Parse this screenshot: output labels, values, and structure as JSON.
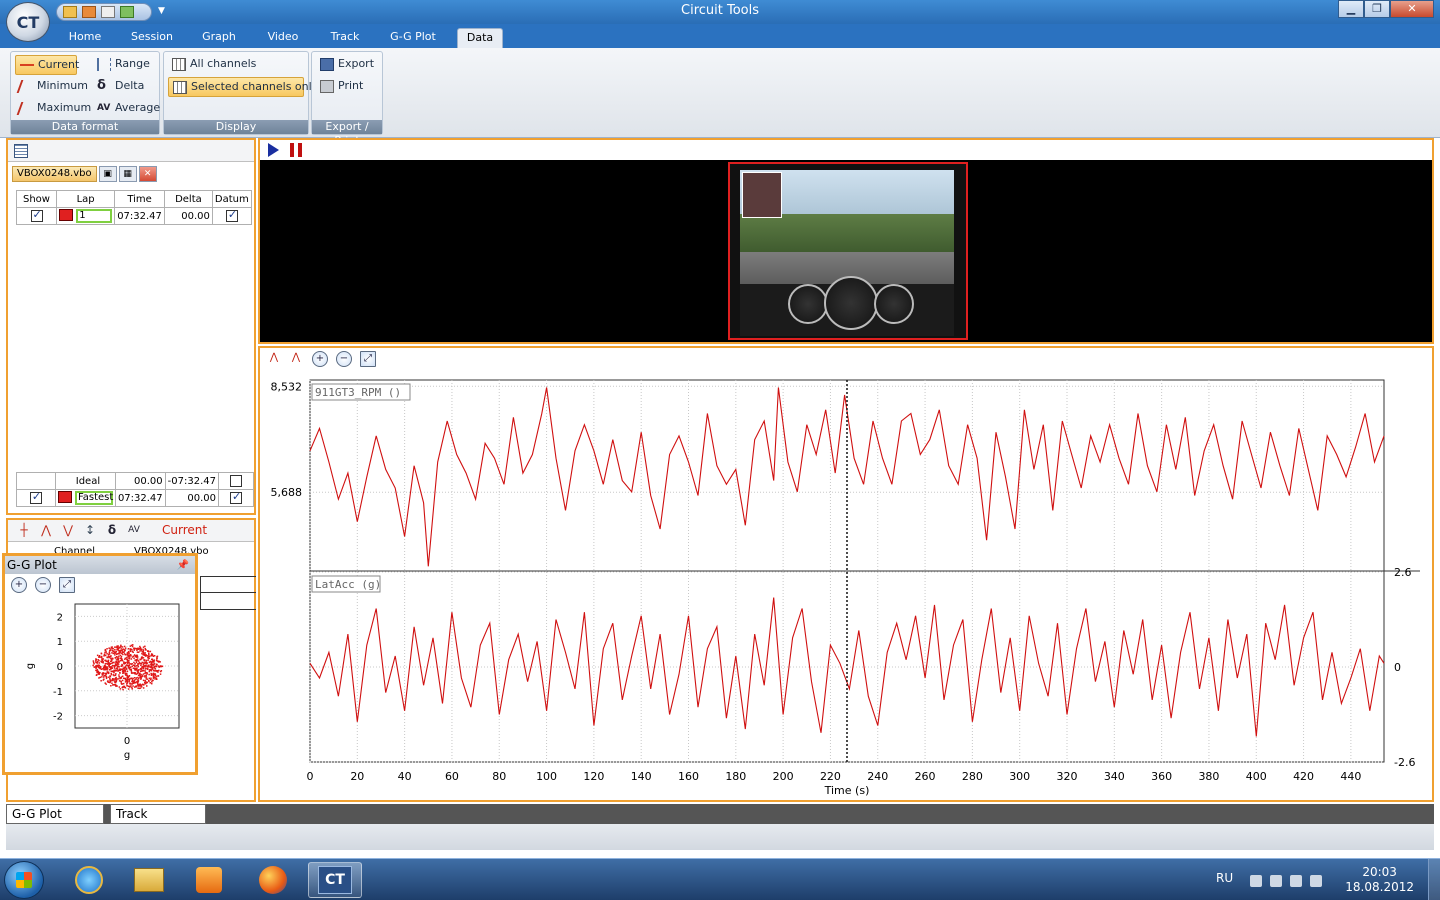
{
  "window": {
    "title": "Circuit Tools",
    "app_logo": "CT"
  },
  "tabs": [
    "Home",
    "Session",
    "Graph",
    "Video",
    "Track",
    "G-G Plot",
    "Data"
  ],
  "active_tab": "Data",
  "ribbon": {
    "data_format": {
      "label": "Data format",
      "current": "Current",
      "range": "Range",
      "minimum": "Minimum",
      "delta": "Delta",
      "maximum": "Maximum",
      "average": "Average"
    },
    "display": {
      "label": "Display",
      "all_channels": "All channels",
      "selected_channels_only": "Selected channels only"
    },
    "export_print": {
      "label": "Export / Print",
      "export": "Export",
      "print": "Print"
    }
  },
  "laps_panel": {
    "file_name": "VBOX0248.vbo",
    "headers": [
      "Show",
      "Lap",
      "Time",
      "Delta",
      "Datum"
    ],
    "rows": [
      {
        "show": true,
        "color": "#e02020",
        "lap": "1",
        "time": "07:32.47",
        "delta": "00.00",
        "datum": true
      }
    ],
    "summary": [
      {
        "show": null,
        "color": null,
        "lap": "Ideal",
        "time": "00.00",
        "delta": "-07:32.47",
        "datum": false
      },
      {
        "show": true,
        "color": "#e02020",
        "lap": "Fastest",
        "time": "07:32.47",
        "delta": "00.00",
        "datum": true
      }
    ]
  },
  "values_panel": {
    "mode": "Current",
    "channel_header": "Channel",
    "file_header": "VBOX0248.vbo"
  },
  "gg_plot": {
    "title": "G-G Plot",
    "y_ticks": [
      "2",
      "1",
      "0",
      "-1",
      "-2"
    ],
    "x_ticks": [
      "0"
    ],
    "ylabel": "g",
    "xlabel": "g"
  },
  "bottom_tabs": [
    "G-G Plot",
    "Track"
  ],
  "chart_data": {
    "type": "line",
    "xlabel": "Time (s)",
    "xlim": [
      0,
      454
    ],
    "x_ticks": [
      0,
      20,
      40,
      60,
      80,
      100,
      120,
      140,
      160,
      180,
      200,
      220,
      240,
      260,
      280,
      300,
      320,
      340,
      360,
      380,
      400,
      420,
      440
    ],
    "cursor_x": 227,
    "series": [
      {
        "name": "911GT3_RPM ()",
        "color": "#d01010",
        "y_ticks": [
          "8,532",
          "5,688"
        ],
        "ylim": [
          3600,
          8700
        ],
        "x": [
          0,
          4,
          8,
          12,
          16,
          20,
          24,
          28,
          32,
          36,
          40,
          44,
          48,
          50,
          54,
          58,
          62,
          66,
          70,
          74,
          78,
          82,
          86,
          90,
          94,
          98,
          100,
          104,
          108,
          112,
          116,
          120,
          124,
          128,
          132,
          136,
          140,
          144,
          148,
          152,
          156,
          160,
          164,
          168,
          172,
          176,
          180,
          184,
          188,
          192,
          196,
          198,
          202,
          206,
          210,
          214,
          218,
          222,
          226,
          230,
          234,
          238,
          242,
          246,
          250,
          254,
          258,
          262,
          266,
          270,
          274,
          278,
          282,
          286,
          290,
          294,
          298,
          302,
          306,
          310,
          314,
          318,
          322,
          326,
          330,
          334,
          338,
          342,
          346,
          350,
          354,
          358,
          362,
          366,
          370,
          374,
          378,
          382,
          386,
          390,
          394,
          398,
          402,
          406,
          410,
          414,
          418,
          422,
          426,
          430,
          434,
          438,
          442,
          446,
          450,
          454
        ],
        "y": [
          6800,
          7400,
          6500,
          5500,
          6200,
          4900,
          6100,
          7200,
          6300,
          5800,
          4500,
          6400,
          5400,
          3700,
          6500,
          7600,
          6700,
          6200,
          5500,
          7000,
          6600,
          5900,
          7700,
          6200,
          6700,
          7800,
          8500,
          6600,
          5200,
          6800,
          7500,
          6800,
          5900,
          7100,
          6000,
          5700,
          7300,
          5600,
          4700,
          6700,
          7200,
          6500,
          5600,
          7800,
          6400,
          5900,
          6300,
          4800,
          7100,
          7600,
          6000,
          8500,
          6500,
          5700,
          7500,
          6700,
          7900,
          6200,
          8300,
          6600,
          5900,
          7600,
          6600,
          5900,
          7600,
          7800,
          6700,
          7100,
          7900,
          6400,
          5900,
          7500,
          6600,
          4400,
          7300,
          6100,
          4700,
          7900,
          6300,
          7500,
          5200,
          7600,
          6700,
          5800,
          7200,
          6500,
          7500,
          6600,
          5900,
          7800,
          6400,
          5700,
          7500,
          6300,
          7700,
          5600,
          6800,
          7500,
          6400,
          5500,
          7600,
          6700,
          5800,
          7300,
          6400,
          5600,
          7400,
          6300,
          5200,
          7200,
          6700,
          6100,
          6900,
          7800,
          6500,
          7200
        ]
      },
      {
        "name": "LatAcc (g)",
        "color": "#d01010",
        "y_ticks": [
          "2.6",
          "0",
          "-2.6"
        ],
        "ylim": [
          -2.6,
          2.6
        ],
        "x": [
          0,
          4,
          8,
          12,
          16,
          20,
          24,
          28,
          32,
          36,
          40,
          44,
          48,
          52,
          56,
          60,
          64,
          68,
          72,
          76,
          80,
          84,
          88,
          92,
          96,
          100,
          104,
          108,
          112,
          116,
          120,
          124,
          128,
          132,
          136,
          140,
          144,
          148,
          152,
          156,
          160,
          164,
          168,
          172,
          176,
          180,
          184,
          188,
          192,
          196,
          200,
          204,
          208,
          212,
          216,
          220,
          224,
          228,
          232,
          236,
          240,
          244,
          248,
          252,
          256,
          260,
          264,
          268,
          272,
          276,
          280,
          284,
          288,
          292,
          296,
          300,
          304,
          308,
          312,
          316,
          320,
          324,
          328,
          332,
          336,
          340,
          344,
          348,
          352,
          356,
          360,
          364,
          368,
          372,
          376,
          380,
          384,
          388,
          392,
          396,
          400,
          404,
          408,
          412,
          416,
          420,
          424,
          428,
          432,
          436,
          440,
          444,
          448,
          452,
          454
        ],
        "y": [
          0.1,
          -0.3,
          0.4,
          -0.8,
          0.9,
          -1.5,
          0.6,
          1.6,
          -0.7,
          0.3,
          -1.2,
          1.1,
          -0.5,
          0.8,
          -1.0,
          1.5,
          -0.3,
          -1.1,
          0.6,
          1.2,
          -1.3,
          0.2,
          0.9,
          -0.4,
          0.7,
          -1.2,
          1.3,
          0.4,
          -0.6,
          1.5,
          -1.6,
          0.5,
          1.2,
          -0.9,
          0.3,
          1.4,
          -0.6,
          0.9,
          -1.3,
          -0.2,
          1.4,
          -1.1,
          0.5,
          1.1,
          -1.4,
          0.3,
          -1.7,
          0.9,
          -0.5,
          1.9,
          -1.3,
          0.8,
          1.6,
          -0.4,
          -1.8,
          0.6,
          0.1,
          -0.6,
          1.0,
          -0.8,
          -1.6,
          0.4,
          1.2,
          0.2,
          1.4,
          -0.3,
          1.7,
          -0.9,
          0.6,
          1.3,
          -1.5,
          0.2,
          1.6,
          -0.7,
          0.8,
          -1.2,
          1.4,
          0.1,
          -0.8,
          1.2,
          -1.3,
          0.5,
          1.6,
          -0.4,
          0.7,
          -1.1,
          1.0,
          -0.2,
          1.3,
          -0.9,
          0.6,
          -1.4,
          0.4,
          1.5,
          -0.6,
          0.8,
          -1.2,
          1.3,
          -0.3,
          0.9,
          -1.9,
          1.2,
          0.2,
          1.7,
          -0.5,
          0.8,
          1.5,
          -0.9,
          0.4,
          -1.0,
          -0.3,
          0.5,
          -1.2,
          0.3,
          0.1
        ]
      }
    ]
  },
  "taskbar": {
    "apps": [
      "internet-explorer",
      "windows-explorer",
      "media-player",
      "firefox",
      "circuit-tools"
    ],
    "active_app_label": "CT",
    "lang": "RU",
    "time": "20:03",
    "date": "18.08.2012"
  }
}
